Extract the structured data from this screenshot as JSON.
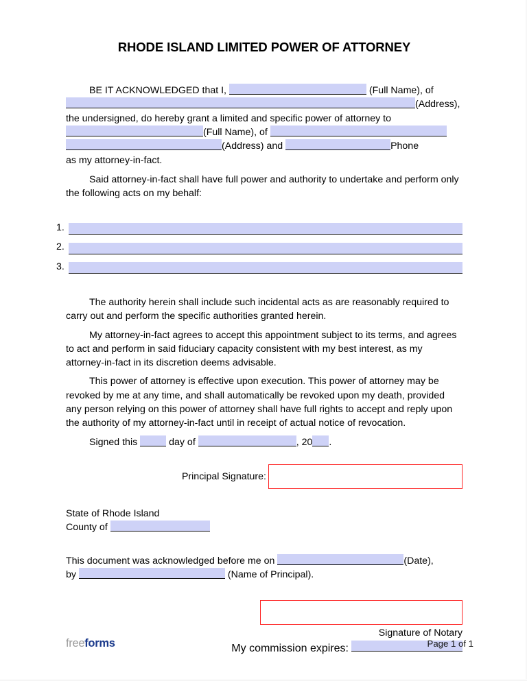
{
  "document": {
    "title": "RHODE ISLAND LIMITED POWER OF ATTORNEY"
  },
  "intro": {
    "seg1": "BE IT ACKNOWLEDGED that I,",
    "seg2": "(Full Name), of",
    "seg3": "(Address),",
    "seg4": "the undersigned, do hereby grant a limited and specific power of attorney to",
    "seg5": "(Full Name), of",
    "seg6": "(Address) and",
    "seg7": "Phone",
    "seg8": "as my attorney-in-fact.",
    "field_principal_name": "",
    "field_principal_address": "",
    "field_agent_name": "",
    "field_agent_address_1": "",
    "field_agent_address_2": "",
    "field_agent_phone": ""
  },
  "powers": {
    "paragraph": "Said attorney-in-fact shall have full power and authority to undertake and perform only the following acts on my behalf:",
    "items": [
      {
        "number": "1.",
        "value": ""
      },
      {
        "number": "2.",
        "value": ""
      },
      {
        "number": "3.",
        "value": ""
      }
    ]
  },
  "body": {
    "paragraph_incidental": "The authority herein shall include such incidental acts as are reasonably required to carry out and perform the specific authorities granted herein.",
    "paragraph_acceptance": "My attorney-in-fact agrees to accept this appointment subject to its terms, and agrees to act and perform in said fiduciary capacity consistent with my best interest, as my attorney-in-fact in its discretion deems advisable.",
    "paragraph_effective": "This power of attorney is effective upon execution. This power of attorney may be revoked by me at any time, and shall automatically be revoked upon my death, provided any person relying on this power of attorney shall have full rights to accept and reply upon the authority of my attorney-in-fact until in receipt of actual notice of revocation."
  },
  "signed_line": {
    "seg1": "Signed this",
    "seg2": "day of",
    "seg3": ", 20",
    "seg4": ".",
    "field_day": "",
    "field_month": "",
    "field_year": ""
  },
  "principal_signature": {
    "label": "Principal Signature:",
    "value": ""
  },
  "notary": {
    "state_line": "State of Rhode Island",
    "county_label": "County of",
    "field_county": "",
    "ack_seg1": "This document was acknowledged before me on",
    "ack_seg2": "(Date),",
    "ack_seg3": "by",
    "ack_seg4": "(Name of Principal).",
    "field_date": "",
    "field_principal_name": "",
    "signature_value": "",
    "signature_caption": "Signature of Notary",
    "commission_label": "My commission expires:",
    "field_commission": ""
  },
  "footer": {
    "logo_part1": "free",
    "logo_part2": "forms",
    "page_number": "Page 1 of 1"
  },
  "colors": {
    "field_fill": "#ced2f7",
    "signature_border": "#fe2020",
    "logo_gray": "#9a9a9a",
    "logo_blue": "#1b3a8c",
    "text": "#000000"
  }
}
